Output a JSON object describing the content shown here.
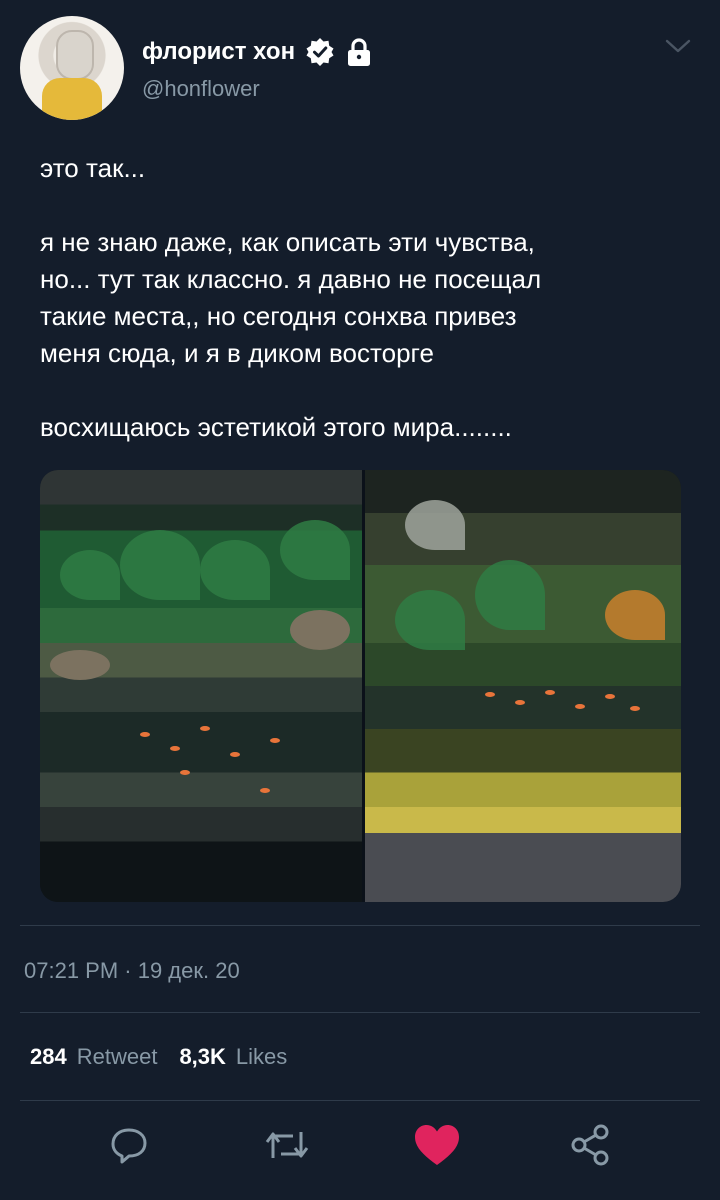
{
  "author": {
    "name": "флорист хон",
    "handle": "@honflower",
    "verified": true,
    "protected": true
  },
  "tweet": {
    "lines": [
      "это так...",
      "",
      "я не знаю даже, как описать эти чувства,",
      "но... тут так классно. я давно не посещал",
      "такие места,, но сегодня сонхва привез",
      "меня сюда, и я в диком восторге",
      "",
      "восхищаюсь эстетикой этого мира........"
    ],
    "time": "07:21 PM · 19 дек. 20"
  },
  "stats": {
    "retweets": "284",
    "retweets_label": "Retweet",
    "likes": "8,3K",
    "likes_label": "Likes"
  },
  "actions": {
    "reply_icon": "reply-icon",
    "retweet_icon": "retweet-icon",
    "like_icon": "heart-icon",
    "share_icon": "share-icon",
    "liked": true
  },
  "colors": {
    "background": "#141d2b",
    "muted": "#8899a6",
    "like": "#e0245e",
    "divider": "#2f3b4a"
  }
}
